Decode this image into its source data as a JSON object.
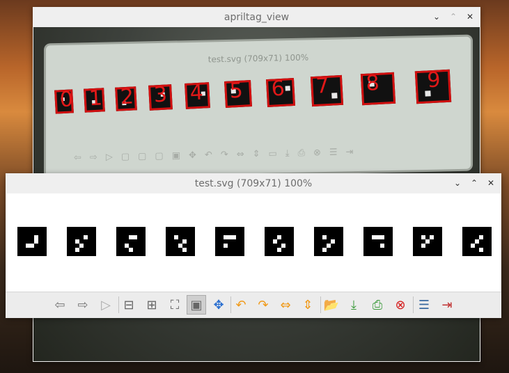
{
  "win1": {
    "title": "apriltag_view"
  },
  "camera": {
    "monitor_title": "test.svg (709x71) 100%",
    "tags": [
      "0",
      "1",
      "2",
      "3",
      "4",
      "5",
      "6",
      "7",
      "8",
      "9"
    ]
  },
  "win2": {
    "title": "test.svg (709x71) 100%"
  },
  "controls": {
    "minimize": "⌄",
    "maximize": "⌃",
    "close": "✕"
  },
  "toolbar": {
    "back": "⇦",
    "forward": "⇨",
    "play": "▷",
    "zoom_out": "⊟",
    "zoom_in": "⊞",
    "fit": "⛶",
    "actual": "▣",
    "fullscreen": "✥",
    "rot_left": "↶",
    "rot_right": "↷",
    "flip_h": "⇔",
    "flip_v": "⇕",
    "open": "📂",
    "save": "⤓",
    "print": "⎙",
    "delete": "⊗",
    "prefs": "☰",
    "quit": "⇥"
  },
  "colors": {
    "detect_outline": "#d11010",
    "delete_red": "#d51a1a",
    "rotate_orange": "#f09a1a"
  }
}
